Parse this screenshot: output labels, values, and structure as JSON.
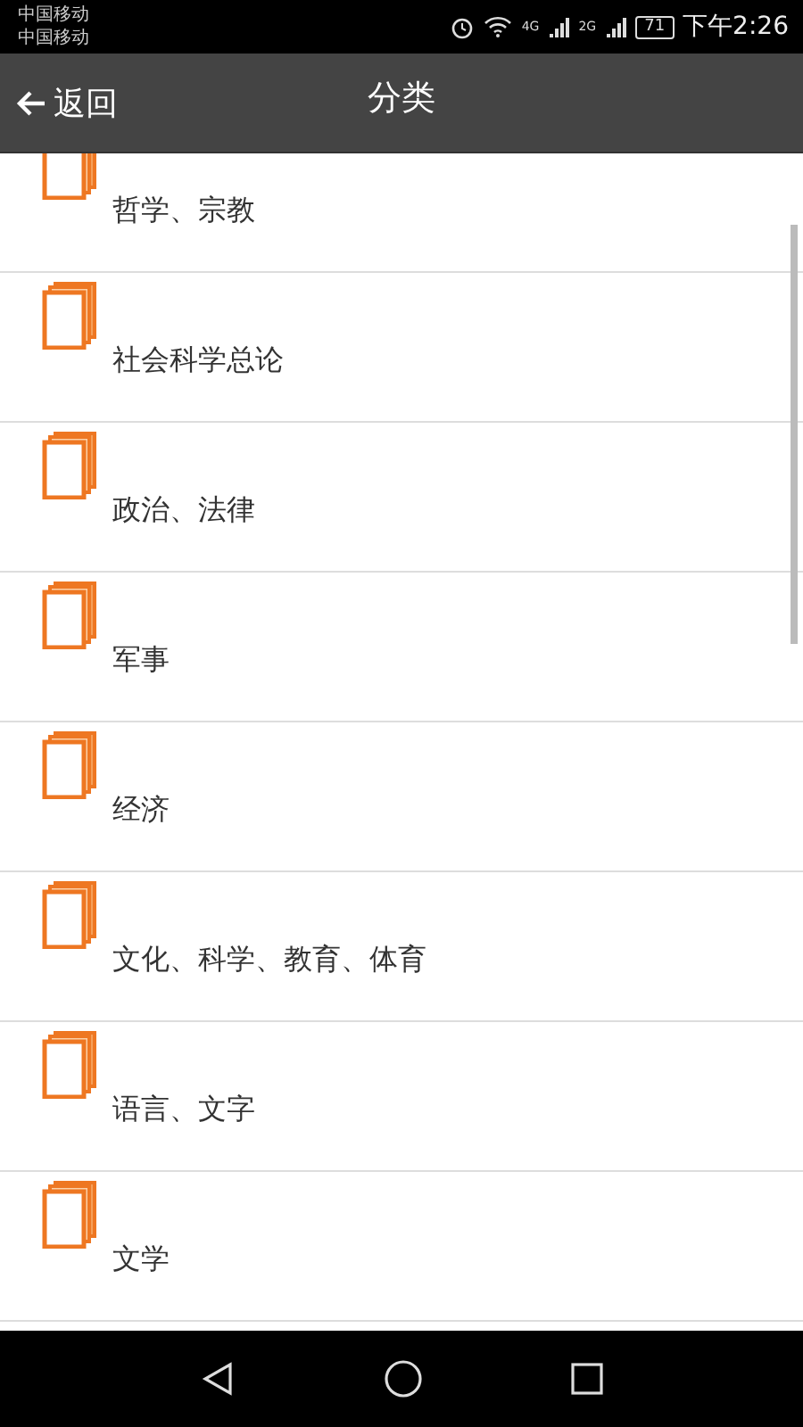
{
  "status_bar": {
    "carriers": [
      "中国移动",
      "中国移动"
    ],
    "battery": "71",
    "network_1": "4G",
    "network_2": "2G",
    "time": "下午2:26"
  },
  "toolbar": {
    "back_label": "返回",
    "title": "分类"
  },
  "categories": [
    {
      "label": "哲学、宗教"
    },
    {
      "label": "社会科学总论"
    },
    {
      "label": "政治、法律"
    },
    {
      "label": "军事"
    },
    {
      "label": "经济"
    },
    {
      "label": "文化、科学、教育、体育"
    },
    {
      "label": "语言、文字"
    },
    {
      "label": "文学"
    }
  ]
}
